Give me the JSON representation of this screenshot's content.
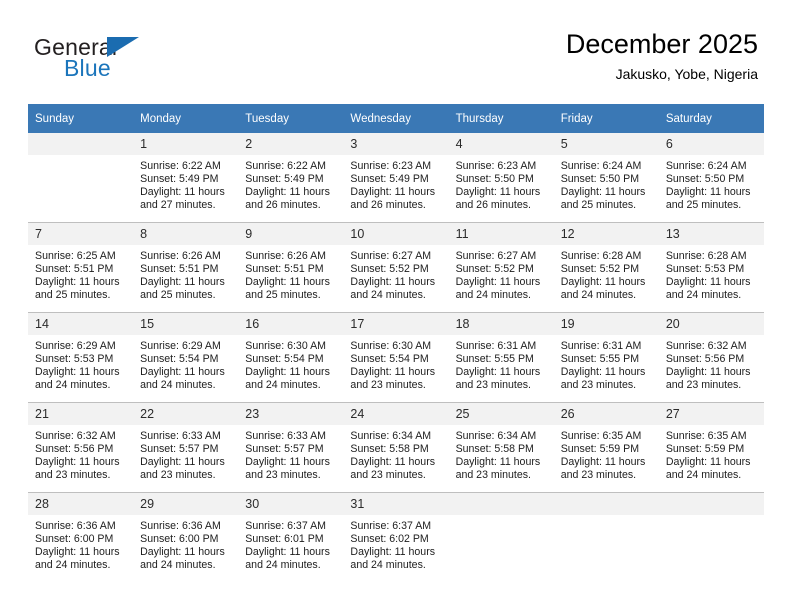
{
  "brand": {
    "name_part1": "General",
    "name_part2": "Blue",
    "accent_color": "#1b75bb"
  },
  "header": {
    "title": "December 2025",
    "subtitle": "Jakusko, Yobe, Nigeria"
  },
  "calendar": {
    "header_bg": "#3a78b5",
    "weekday_headers": [
      "Sunday",
      "Monday",
      "Tuesday",
      "Wednesday",
      "Thursday",
      "Friday",
      "Saturday"
    ],
    "weeks": [
      [
        {
          "day": "",
          "sunrise": "",
          "sunset": "",
          "daylight1": "",
          "daylight2": ""
        },
        {
          "day": "1",
          "sunrise": "Sunrise: 6:22 AM",
          "sunset": "Sunset: 5:49 PM",
          "daylight1": "Daylight: 11 hours",
          "daylight2": "and 27 minutes."
        },
        {
          "day": "2",
          "sunrise": "Sunrise: 6:22 AM",
          "sunset": "Sunset: 5:49 PM",
          "daylight1": "Daylight: 11 hours",
          "daylight2": "and 26 minutes."
        },
        {
          "day": "3",
          "sunrise": "Sunrise: 6:23 AM",
          "sunset": "Sunset: 5:49 PM",
          "daylight1": "Daylight: 11 hours",
          "daylight2": "and 26 minutes."
        },
        {
          "day": "4",
          "sunrise": "Sunrise: 6:23 AM",
          "sunset": "Sunset: 5:50 PM",
          "daylight1": "Daylight: 11 hours",
          "daylight2": "and 26 minutes."
        },
        {
          "day": "5",
          "sunrise": "Sunrise: 6:24 AM",
          "sunset": "Sunset: 5:50 PM",
          "daylight1": "Daylight: 11 hours",
          "daylight2": "and 25 minutes."
        },
        {
          "day": "6",
          "sunrise": "Sunrise: 6:24 AM",
          "sunset": "Sunset: 5:50 PM",
          "daylight1": "Daylight: 11 hours",
          "daylight2": "and 25 minutes."
        }
      ],
      [
        {
          "day": "7",
          "sunrise": "Sunrise: 6:25 AM",
          "sunset": "Sunset: 5:51 PM",
          "daylight1": "Daylight: 11 hours",
          "daylight2": "and 25 minutes."
        },
        {
          "day": "8",
          "sunrise": "Sunrise: 6:26 AM",
          "sunset": "Sunset: 5:51 PM",
          "daylight1": "Daylight: 11 hours",
          "daylight2": "and 25 minutes."
        },
        {
          "day": "9",
          "sunrise": "Sunrise: 6:26 AM",
          "sunset": "Sunset: 5:51 PM",
          "daylight1": "Daylight: 11 hours",
          "daylight2": "and 25 minutes."
        },
        {
          "day": "10",
          "sunrise": "Sunrise: 6:27 AM",
          "sunset": "Sunset: 5:52 PM",
          "daylight1": "Daylight: 11 hours",
          "daylight2": "and 24 minutes."
        },
        {
          "day": "11",
          "sunrise": "Sunrise: 6:27 AM",
          "sunset": "Sunset: 5:52 PM",
          "daylight1": "Daylight: 11 hours",
          "daylight2": "and 24 minutes."
        },
        {
          "day": "12",
          "sunrise": "Sunrise: 6:28 AM",
          "sunset": "Sunset: 5:52 PM",
          "daylight1": "Daylight: 11 hours",
          "daylight2": "and 24 minutes."
        },
        {
          "day": "13",
          "sunrise": "Sunrise: 6:28 AM",
          "sunset": "Sunset: 5:53 PM",
          "daylight1": "Daylight: 11 hours",
          "daylight2": "and 24 minutes."
        }
      ],
      [
        {
          "day": "14",
          "sunrise": "Sunrise: 6:29 AM",
          "sunset": "Sunset: 5:53 PM",
          "daylight1": "Daylight: 11 hours",
          "daylight2": "and 24 minutes."
        },
        {
          "day": "15",
          "sunrise": "Sunrise: 6:29 AM",
          "sunset": "Sunset: 5:54 PM",
          "daylight1": "Daylight: 11 hours",
          "daylight2": "and 24 minutes."
        },
        {
          "day": "16",
          "sunrise": "Sunrise: 6:30 AM",
          "sunset": "Sunset: 5:54 PM",
          "daylight1": "Daylight: 11 hours",
          "daylight2": "and 24 minutes."
        },
        {
          "day": "17",
          "sunrise": "Sunrise: 6:30 AM",
          "sunset": "Sunset: 5:54 PM",
          "daylight1": "Daylight: 11 hours",
          "daylight2": "and 23 minutes."
        },
        {
          "day": "18",
          "sunrise": "Sunrise: 6:31 AM",
          "sunset": "Sunset: 5:55 PM",
          "daylight1": "Daylight: 11 hours",
          "daylight2": "and 23 minutes."
        },
        {
          "day": "19",
          "sunrise": "Sunrise: 6:31 AM",
          "sunset": "Sunset: 5:55 PM",
          "daylight1": "Daylight: 11 hours",
          "daylight2": "and 23 minutes."
        },
        {
          "day": "20",
          "sunrise": "Sunrise: 6:32 AM",
          "sunset": "Sunset: 5:56 PM",
          "daylight1": "Daylight: 11 hours",
          "daylight2": "and 23 minutes."
        }
      ],
      [
        {
          "day": "21",
          "sunrise": "Sunrise: 6:32 AM",
          "sunset": "Sunset: 5:56 PM",
          "daylight1": "Daylight: 11 hours",
          "daylight2": "and 23 minutes."
        },
        {
          "day": "22",
          "sunrise": "Sunrise: 6:33 AM",
          "sunset": "Sunset: 5:57 PM",
          "daylight1": "Daylight: 11 hours",
          "daylight2": "and 23 minutes."
        },
        {
          "day": "23",
          "sunrise": "Sunrise: 6:33 AM",
          "sunset": "Sunset: 5:57 PM",
          "daylight1": "Daylight: 11 hours",
          "daylight2": "and 23 minutes."
        },
        {
          "day": "24",
          "sunrise": "Sunrise: 6:34 AM",
          "sunset": "Sunset: 5:58 PM",
          "daylight1": "Daylight: 11 hours",
          "daylight2": "and 23 minutes."
        },
        {
          "day": "25",
          "sunrise": "Sunrise: 6:34 AM",
          "sunset": "Sunset: 5:58 PM",
          "daylight1": "Daylight: 11 hours",
          "daylight2": "and 23 minutes."
        },
        {
          "day": "26",
          "sunrise": "Sunrise: 6:35 AM",
          "sunset": "Sunset: 5:59 PM",
          "daylight1": "Daylight: 11 hours",
          "daylight2": "and 23 minutes."
        },
        {
          "day": "27",
          "sunrise": "Sunrise: 6:35 AM",
          "sunset": "Sunset: 5:59 PM",
          "daylight1": "Daylight: 11 hours",
          "daylight2": "and 24 minutes."
        }
      ],
      [
        {
          "day": "28",
          "sunrise": "Sunrise: 6:36 AM",
          "sunset": "Sunset: 6:00 PM",
          "daylight1": "Daylight: 11 hours",
          "daylight2": "and 24 minutes."
        },
        {
          "day": "29",
          "sunrise": "Sunrise: 6:36 AM",
          "sunset": "Sunset: 6:00 PM",
          "daylight1": "Daylight: 11 hours",
          "daylight2": "and 24 minutes."
        },
        {
          "day": "30",
          "sunrise": "Sunrise: 6:37 AM",
          "sunset": "Sunset: 6:01 PM",
          "daylight1": "Daylight: 11 hours",
          "daylight2": "and 24 minutes."
        },
        {
          "day": "31",
          "sunrise": "Sunrise: 6:37 AM",
          "sunset": "Sunset: 6:02 PM",
          "daylight1": "Daylight: 11 hours",
          "daylight2": "and 24 minutes."
        },
        {
          "day": "",
          "sunrise": "",
          "sunset": "",
          "daylight1": "",
          "daylight2": ""
        },
        {
          "day": "",
          "sunrise": "",
          "sunset": "",
          "daylight1": "",
          "daylight2": ""
        },
        {
          "day": "",
          "sunrise": "",
          "sunset": "",
          "daylight1": "",
          "daylight2": ""
        }
      ]
    ]
  }
}
